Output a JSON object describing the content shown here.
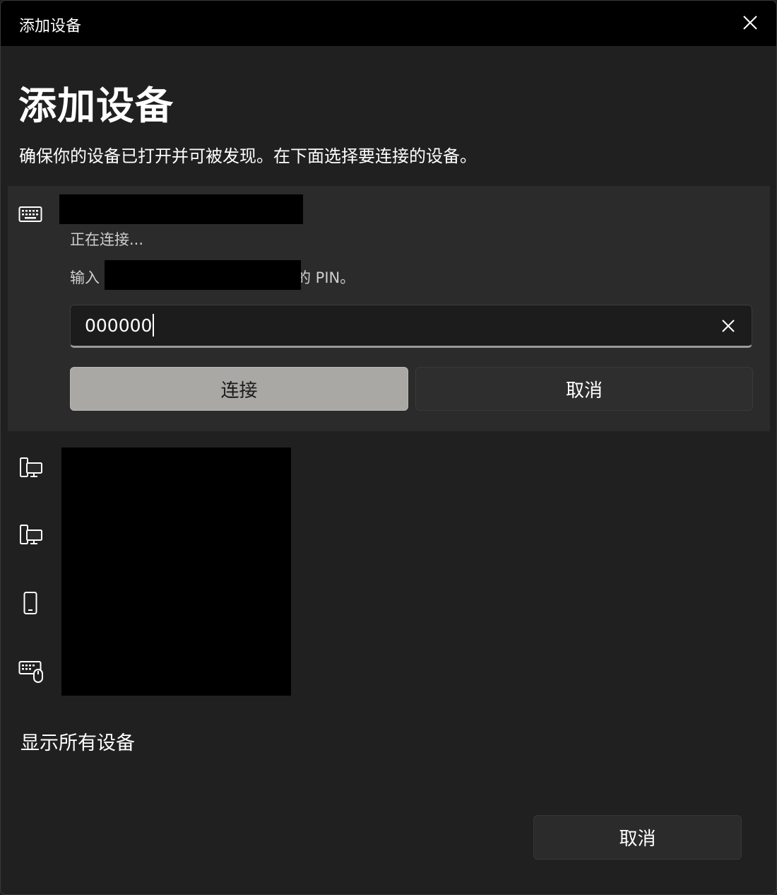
{
  "window": {
    "title": "添加设备",
    "close_icon": "close-icon"
  },
  "page": {
    "heading": "添加设备",
    "description": "确保你的设备已打开并可被发现。在下面选择要连接的设备。"
  },
  "active_device": {
    "icon": "keyboard-icon",
    "status": "正在连接...",
    "pin_prompt_prefix": "输入",
    "pin_prompt_suffix": "的 PIN。",
    "pin_value": "000000",
    "connect_label": "连接",
    "cancel_label": "取消"
  },
  "device_list": [
    {
      "icon": "pc-monitor-icon"
    },
    {
      "icon": "pc-monitor-icon"
    },
    {
      "icon": "phone-icon"
    },
    {
      "icon": "keyboard-mouse-icon"
    }
  ],
  "show_all_label": "显示所有设备",
  "footer": {
    "cancel_label": "取消"
  },
  "colors": {
    "background": "#202020",
    "titlebar": "#000000",
    "card": "#2b2b2b",
    "primary_button": "#a9a8a4"
  }
}
